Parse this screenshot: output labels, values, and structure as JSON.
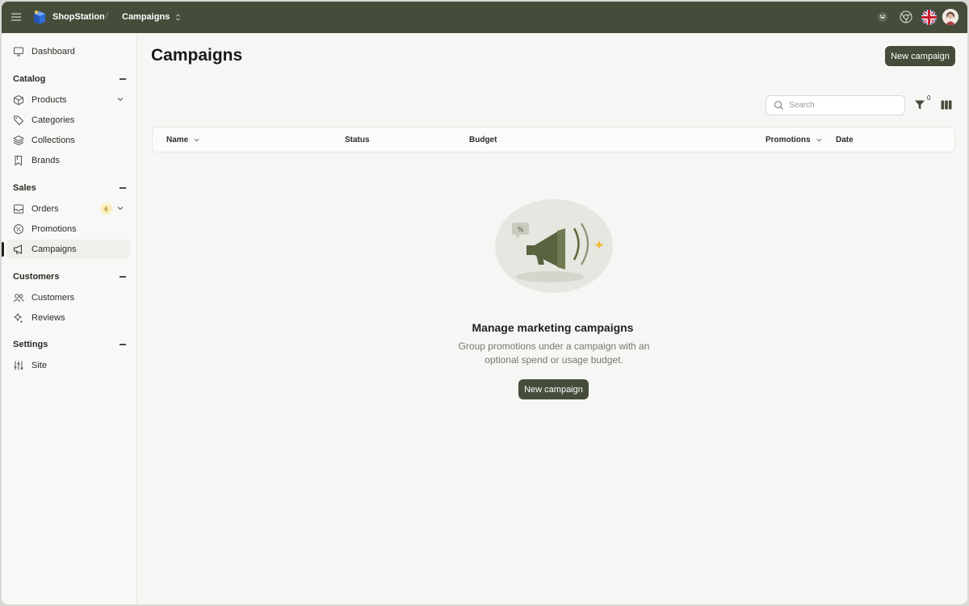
{
  "topbar": {
    "brand": "ShopStation",
    "separator": "/",
    "breadcrumb": "Campaigns"
  },
  "sidebar": {
    "dashboard": "Dashboard",
    "sections": {
      "catalog": "Catalog",
      "sales": "Sales",
      "customers": "Customers",
      "settings": "Settings"
    },
    "items": {
      "products": "Products",
      "categories": "Categories",
      "collections": "Collections",
      "brands": "Brands",
      "orders": "Orders",
      "orders_badge": "6",
      "promotions": "Promotions",
      "campaigns": "Campaigns",
      "customers": "Customers",
      "reviews": "Reviews",
      "site": "Site"
    }
  },
  "main": {
    "title": "Campaigns",
    "new_campaign_label": "New campaign",
    "search_placeholder": "Search",
    "filter_count": "0",
    "columns": {
      "name": "Name",
      "status": "Status",
      "budget": "Budget",
      "promotions": "Promotions",
      "date": "Date"
    },
    "empty": {
      "title": "Manage marketing campaigns",
      "description": "Group promotions under a campaign with an optional spend or usage budget.",
      "button": "New campaign"
    }
  },
  "colors": {
    "topbar": "#454d3a",
    "accent": "#454d3a",
    "badge_bg": "#fbeebd",
    "badge_text": "#8a6a00",
    "spark": "#f5b731"
  },
  "icons": {
    "menu": "hamburger-icon",
    "dashboard": "monitor-icon",
    "products": "box-icon",
    "categories": "tag-icon",
    "collections": "layers-icon",
    "brands": "bookmark-icon",
    "orders": "inbox-icon",
    "promotions": "percent-badge-icon",
    "campaigns": "megaphone-icon",
    "customers": "users-icon",
    "reviews": "sparkle-icon",
    "site": "sliders-icon",
    "search": "search-icon",
    "filter": "funnel-icon",
    "columns": "columns-icon"
  }
}
